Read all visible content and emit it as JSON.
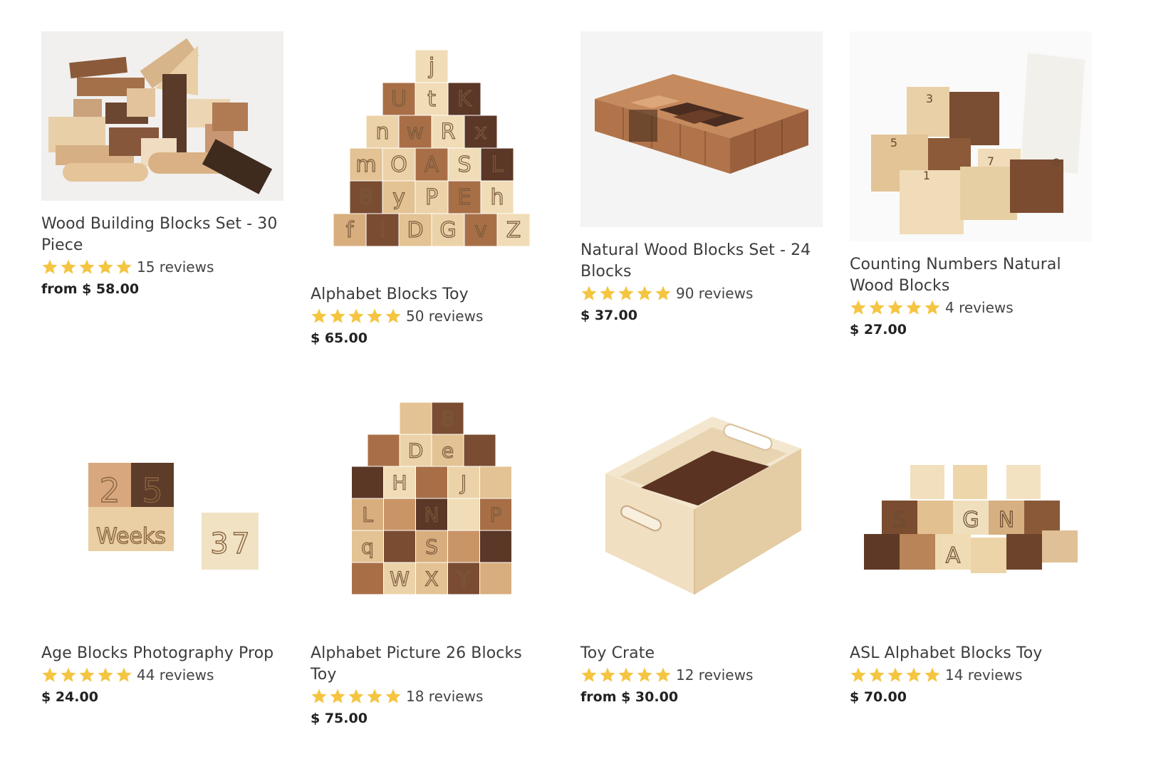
{
  "products": [
    {
      "name": "Wood Building Blocks Set - 30 Piece",
      "reviews": "15 reviews",
      "price": "from $ 58.00"
    },
    {
      "name": "Alphabet Blocks Toy",
      "reviews": "50 reviews",
      "price": "$ 65.00"
    },
    {
      "name": "Natural Wood Blocks Set - 24 Blocks",
      "reviews": "90 reviews",
      "price": "$ 37.00"
    },
    {
      "name": "Counting Numbers Natural Wood Blocks",
      "reviews": "4 reviews",
      "price": "$ 27.00"
    },
    {
      "name": "Age Blocks Photography Prop",
      "reviews": "44 reviews",
      "price": "$ 24.00"
    },
    {
      "name": "Alphabet Picture 26 Blocks Toy",
      "reviews": "18 reviews",
      "price": "$ 75.00"
    },
    {
      "name": "Toy Crate",
      "reviews": "12 reviews",
      "price": "from $ 30.00"
    },
    {
      "name": "ASL Alphabet Blocks Toy",
      "reviews": "14 reviews",
      "price": "$ 70.00"
    }
  ],
  "block_letters": {
    "alphabet": [
      [
        "j"
      ],
      [
        "U",
        "t",
        "K"
      ],
      [
        "n",
        "w",
        "R",
        "x"
      ],
      [
        "m",
        "O",
        "A",
        "S",
        "L"
      ],
      [
        "B",
        "y",
        "P",
        "E",
        "h"
      ],
      [
        "f",
        "i",
        "D",
        "G",
        "v",
        "Z"
      ]
    ],
    "weeks": [
      "2",
      "5",
      "Weeks",
      "3",
      "7"
    ],
    "numbers": [
      "3",
      "5",
      "1",
      "7",
      "8"
    ],
    "picture": [
      [
        "B"
      ],
      [
        "D",
        "e"
      ],
      [
        "H",
        "J"
      ],
      [
        "L",
        "N",
        "P"
      ],
      [
        "q",
        "S"
      ],
      [
        "W",
        "X",
        "Y"
      ]
    ],
    "asl": [
      "S",
      "G",
      "N",
      "A"
    ]
  },
  "colors": {
    "star": "#f5c542",
    "text": "#3c3c3c",
    "price": "#222222"
  },
  "icons": {
    "rating": "star-icon"
  }
}
